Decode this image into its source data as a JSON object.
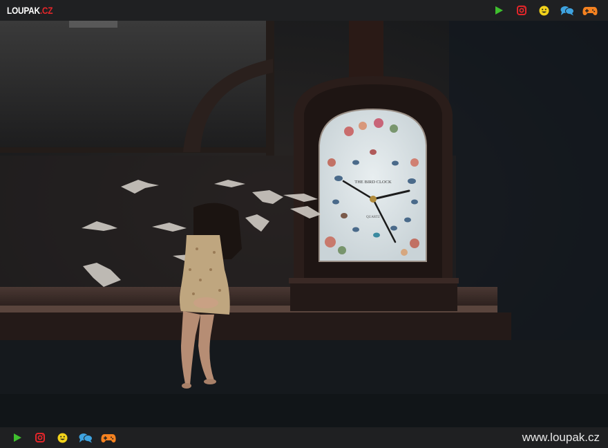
{
  "header": {
    "logo_main": "LOUPAK",
    "logo_tld": ".CZ",
    "nav_icons": [
      "play-icon",
      "instagram-icon",
      "smiley-icon",
      "chat-icon",
      "gamepad-icon"
    ]
  },
  "photo": {
    "clock_face_text": "THE BIRD CLOCK",
    "clock_brand_text": "QUARTZ"
  },
  "footer": {
    "site_url": "www.loupak.cz",
    "nav_icons": [
      "play-icon",
      "instagram-icon",
      "smiley-icon",
      "chat-icon",
      "gamepad-icon"
    ]
  },
  "colors": {
    "play": "#3fbf2e",
    "instagram": "#e3262a",
    "smiley": "#f2d21b",
    "chat": "#3ea3e0",
    "gamepad": "#f58220",
    "logo_accent": "#e3262a"
  }
}
